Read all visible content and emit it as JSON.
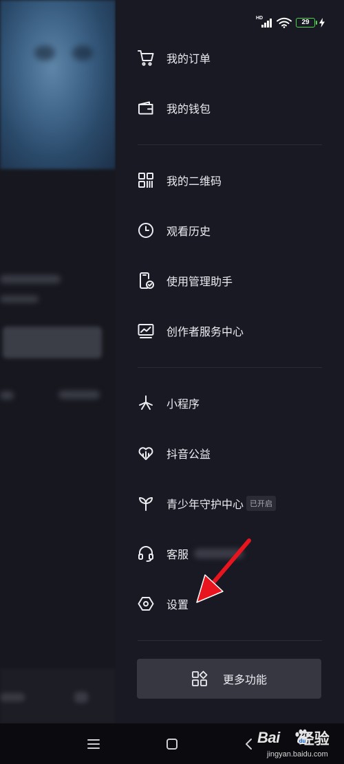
{
  "status_bar": {
    "signal": "HD",
    "battery_level": "29",
    "accent_battery": "#4fd44f"
  },
  "drawer": {
    "items": [
      {
        "label": "我的订单",
        "icon": "cart-icon"
      },
      {
        "label": "我的钱包",
        "icon": "wallet-icon"
      },
      {
        "label": "我的二维码",
        "icon": "qr-code-icon"
      },
      {
        "label": "观看历史",
        "icon": "clock-icon"
      },
      {
        "label": "使用管理助手",
        "icon": "phone-check-icon"
      },
      {
        "label": "创作者服务中心",
        "icon": "monitor-chart-icon"
      },
      {
        "label": "小程序",
        "icon": "mini-program-icon"
      },
      {
        "label": "抖音公益",
        "icon": "heart-chart-icon"
      },
      {
        "label": "青少年守护中心",
        "icon": "sprout-icon",
        "badge": "已开启"
      },
      {
        "label": "客服",
        "icon": "headset-icon"
      },
      {
        "label": "设置",
        "icon": "settings-hex-icon"
      }
    ],
    "more_button": {
      "label": "更多功能",
      "icon": "apps-grid-icon"
    }
  },
  "nav_bar": {
    "buttons": [
      "menu-icon",
      "home-square-icon",
      "back-chevron-icon"
    ]
  },
  "watermark": {
    "brand": "Bai",
    "suffix": "经验",
    "url": "jingyan.baidu.com"
  },
  "colors": {
    "drawer_bg": "#181923",
    "text": "#ececf1",
    "arrow": "#e8141e"
  }
}
